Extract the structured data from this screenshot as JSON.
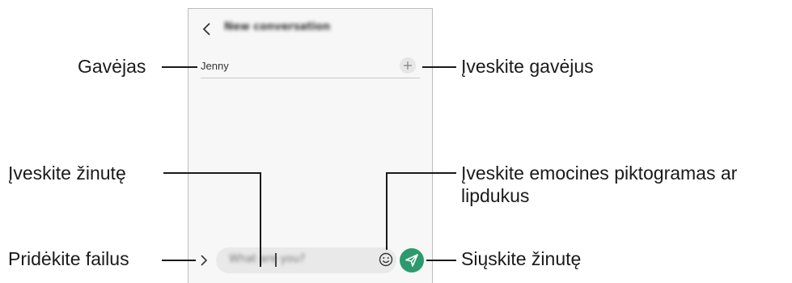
{
  "screen": {
    "title": "New conversation",
    "recipient": "Jenny",
    "message_placeholder": "What are you?"
  },
  "callouts": {
    "recipient": "Gavėjas",
    "enter_recipients": "Įveskite gavėjus",
    "enter_message": "Įveskite žinutę",
    "emoji_stickers": "Įveskite emocines piktogramas ar lipdukus",
    "attach_files": "Pridėkite failus",
    "send_message": "Siųskite žinutę"
  },
  "icons": {
    "back": "back-arrow-icon",
    "add_recipient": "plus-icon",
    "emoji": "smiley-icon",
    "attach": "chevron-right-icon",
    "send": "paper-plane-icon"
  },
  "colors": {
    "send_button": "#2c9a6e",
    "screen_background": "#f7f7f7"
  }
}
